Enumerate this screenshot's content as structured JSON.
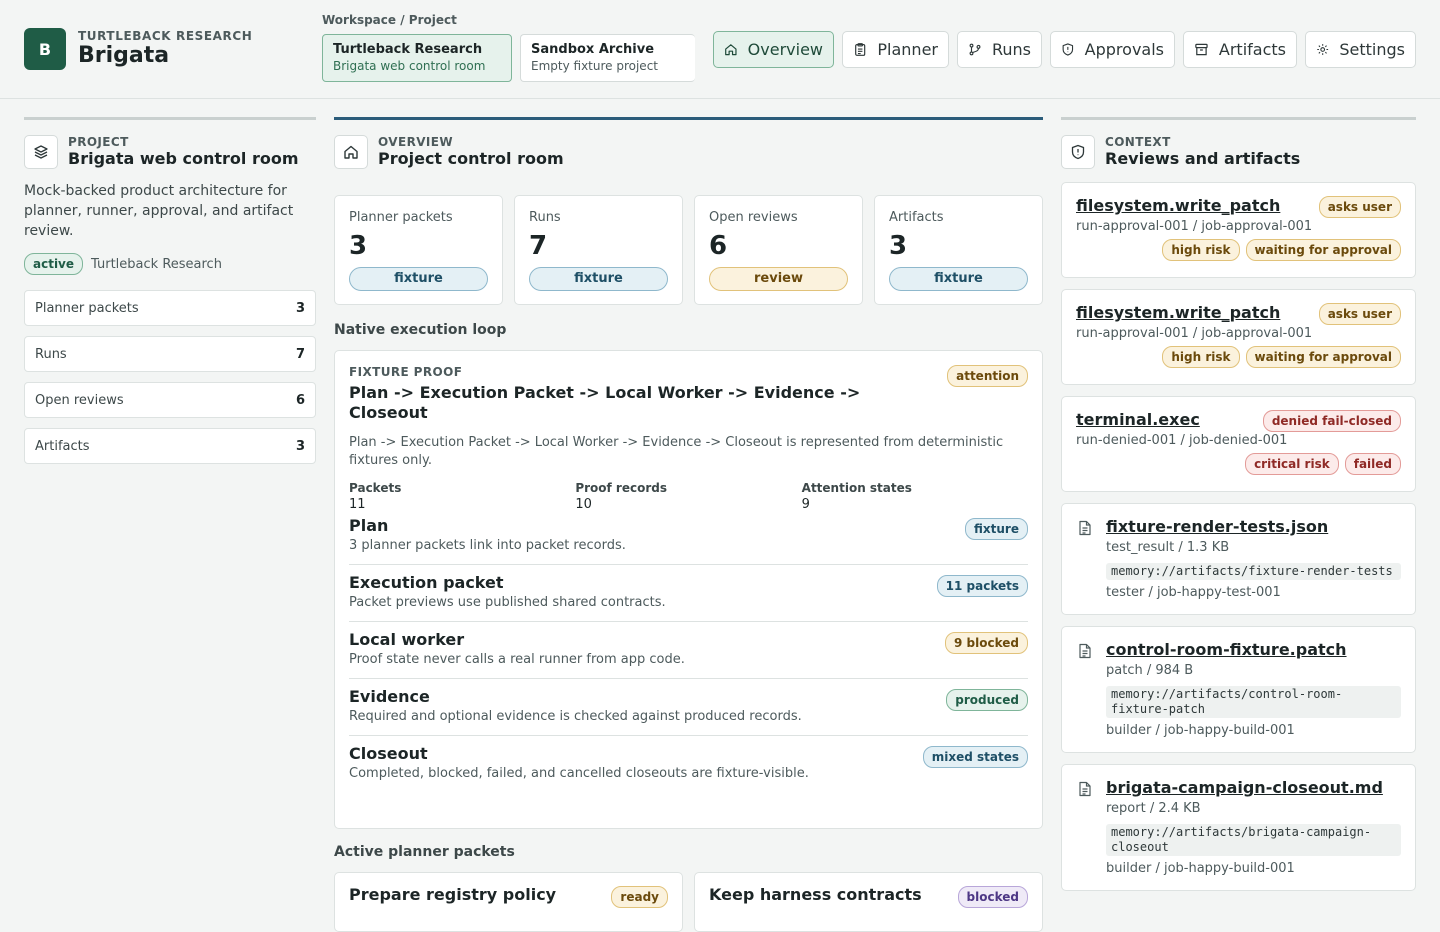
{
  "brand": {
    "logo_letter": "B",
    "org": "TURTLEBACK RESEARCH",
    "name": "Brigata"
  },
  "workspace": {
    "label": "Workspace / Project",
    "cards": [
      {
        "title": "Turtleback Research",
        "sub": "Brigata web control room"
      },
      {
        "title": "Sandbox Archive",
        "sub": "Empty fixture project"
      }
    ]
  },
  "nav": {
    "items": [
      {
        "label": "Overview",
        "icon": "home-icon",
        "active": true
      },
      {
        "label": "Planner",
        "icon": "clipboard-icon"
      },
      {
        "label": "Runs",
        "icon": "branch-icon"
      },
      {
        "label": "Approvals",
        "icon": "shield-icon"
      },
      {
        "label": "Artifacts",
        "icon": "archive-icon"
      },
      {
        "label": "Settings",
        "icon": "gear-icon"
      }
    ]
  },
  "project": {
    "kicker": "PROJECT",
    "title": "Brigata web control room",
    "description": "Mock-backed product architecture for planner, runner, approval, and artifact review.",
    "status": "active",
    "org": "Turtleback Research",
    "stats": [
      {
        "label": "Planner packets",
        "value": "3"
      },
      {
        "label": "Runs",
        "value": "7"
      },
      {
        "label": "Open reviews",
        "value": "6"
      },
      {
        "label": "Artifacts",
        "value": "3"
      }
    ]
  },
  "overview": {
    "kicker": "OVERVIEW",
    "title": "Project control room",
    "metrics": [
      {
        "label": "Planner packets",
        "value": "3",
        "badge": "fixture",
        "tone": "blue"
      },
      {
        "label": "Runs",
        "value": "7",
        "badge": "fixture",
        "tone": "blue"
      },
      {
        "label": "Open reviews",
        "value": "6",
        "badge": "review",
        "tone": "amber"
      },
      {
        "label": "Artifacts",
        "value": "3",
        "badge": "fixture",
        "tone": "blue"
      }
    ],
    "loop_heading": "Native execution loop",
    "loop": {
      "kicker": "FIXTURE PROOF",
      "title": "Plan -> Execution Packet -> Local Worker -> Evidence -> Closeout",
      "badge": "attention",
      "description": "Plan -> Execution Packet -> Local Worker -> Evidence -> Closeout is represented from deterministic fixtures only.",
      "stats": [
        {
          "label": "Packets",
          "value": "11"
        },
        {
          "label": "Proof records",
          "value": "10"
        },
        {
          "label": "Attention states",
          "value": "9"
        }
      ],
      "steps": [
        {
          "title": "Plan",
          "desc": "3 planner packets link into packet records.",
          "badge": "fixture",
          "tone": "blue"
        },
        {
          "title": "Execution packet",
          "desc": "Packet previews use published shared contracts.",
          "badge": "11 packets",
          "tone": "blue"
        },
        {
          "title": "Local worker",
          "desc": "Proof state never calls a real runner from app code.",
          "badge": "9 blocked",
          "tone": "amber"
        },
        {
          "title": "Evidence",
          "desc": "Required and optional evidence is checked against produced records.",
          "badge": "produced",
          "tone": "green"
        },
        {
          "title": "Closeout",
          "desc": "Completed, blocked, failed, and cancelled closeouts are fixture-visible.",
          "badge": "mixed states",
          "tone": "blue"
        }
      ]
    },
    "packets_heading": "Active planner packets",
    "packets": [
      {
        "title": "Prepare registry policy",
        "badge": "ready",
        "tone": "amber"
      },
      {
        "title": "Keep harness contracts",
        "badge": "blocked",
        "tone": "purple"
      }
    ]
  },
  "context": {
    "kicker": "CONTEXT",
    "title": "Reviews and artifacts",
    "reviews": [
      {
        "title": "filesystem.write_patch",
        "sub": "run-approval-001 / job-approval-001",
        "top_badge": "asks user",
        "top_tone": "amber",
        "tags": [
          {
            "label": "high risk",
            "tone": "amber"
          },
          {
            "label": "waiting for approval",
            "tone": "amber"
          }
        ]
      },
      {
        "title": "filesystem.write_patch",
        "sub": "run-approval-001 / job-approval-001",
        "top_badge": "asks user",
        "top_tone": "amber",
        "tags": [
          {
            "label": "high risk",
            "tone": "amber"
          },
          {
            "label": "waiting for approval",
            "tone": "amber"
          }
        ]
      },
      {
        "title": "terminal.exec",
        "sub": "run-denied-001 / job-denied-001",
        "top_badge": "denied fail-closed",
        "top_tone": "red",
        "tags": [
          {
            "label": "critical risk",
            "tone": "red"
          },
          {
            "label": "failed",
            "tone": "red"
          }
        ]
      }
    ],
    "artifacts": [
      {
        "title": "fixture-render-tests.json",
        "sub": "test_result / 1.3 KB",
        "uri": "memory://artifacts/fixture-render-tests",
        "owner": "tester / job-happy-test-001"
      },
      {
        "title": "control-room-fixture.patch",
        "sub": "patch / 984 B",
        "uri": "memory://artifacts/control-room-fixture-patch",
        "owner": "builder / job-happy-build-001"
      },
      {
        "title": "brigata-campaign-closeout.md",
        "sub": "report / 2.4 KB",
        "uri": "memory://artifacts/brigata-campaign-closeout",
        "owner": "builder / job-happy-build-001"
      }
    ]
  }
}
